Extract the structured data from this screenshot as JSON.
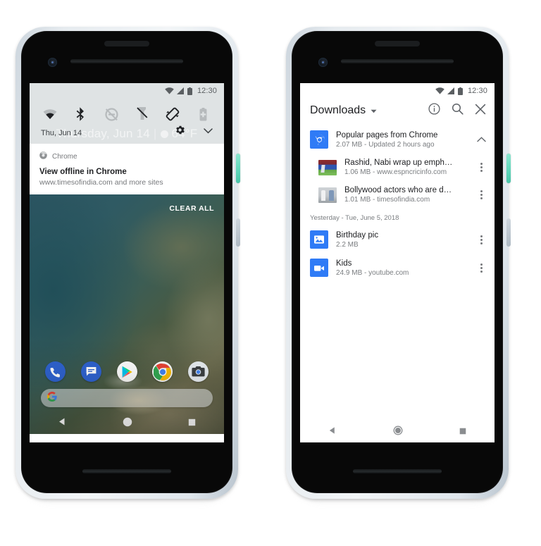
{
  "left_phone": {
    "name": "pixel-phone-quick-settings",
    "status_bar": {
      "time": "12:30",
      "icons": [
        "wifi-icon",
        "signal-icon",
        "battery-icon"
      ]
    },
    "quick_settings": {
      "tiles": [
        {
          "name": "wifi-tile",
          "label": "Wi-Fi"
        },
        {
          "name": "bluetooth-tile",
          "label": "Bluetooth"
        },
        {
          "name": "do-not-disturb-tile",
          "label": "Do Not Disturb"
        },
        {
          "name": "flashlight-tile",
          "label": "Flashlight"
        },
        {
          "name": "auto-rotate-tile",
          "label": "Auto-rotate"
        },
        {
          "name": "battery-saver-tile",
          "label": "Battery Saver"
        }
      ],
      "ghost_widget": "Thursday, Jun 14",
      "ghost_temp": "64°F",
      "date": "Thu, Jun 14",
      "settings_icon": "gear-icon",
      "expand_icon": "chevron-down-icon"
    },
    "notification": {
      "app_icon": "chrome-icon",
      "app_name": "Chrome",
      "title": "View offline in Chrome",
      "subtitle": "www.timesofindia.com and more sites"
    },
    "clear_all_label": "CLEAR ALL",
    "dock": [
      {
        "name": "phone-app-icon",
        "label": "Phone"
      },
      {
        "name": "messages-app-icon",
        "label": "Messages"
      },
      {
        "name": "play-store-app-icon",
        "label": "Play Store"
      },
      {
        "name": "chrome-app-icon",
        "label": "Chrome"
      },
      {
        "name": "camera-app-icon",
        "label": "Camera"
      }
    ],
    "search_bar": {
      "icon": "google-g-icon",
      "placeholder": ""
    },
    "nav_bar": [
      "back-nav-button",
      "home-nav-button",
      "recents-nav-button"
    ]
  },
  "right_phone": {
    "name": "pixel-phone-downloads",
    "status_bar": {
      "time": "12:30",
      "icons": [
        "wifi-icon",
        "signal-icon",
        "battery-icon"
      ]
    },
    "app_bar": {
      "title": "Downloads",
      "caret_icon": "caret-down-icon",
      "actions": [
        {
          "name": "info-button",
          "icon": "info-circle-icon"
        },
        {
          "name": "search-button",
          "icon": "search-icon"
        },
        {
          "name": "close-button",
          "icon": "close-x-icon"
        }
      ]
    },
    "groups": [
      {
        "name": "popular-pages-group",
        "icon": "chrome-icon",
        "title": "Popular pages from Chrome",
        "subtitle": "2.07 MB - Updated 2 hours ago",
        "collapse_icon": "chevron-up-icon",
        "children": [
          {
            "name": "download-item-cricket",
            "thumb": "cricket-thumbnail",
            "title": "Rashid, Nabi wrap up emph…",
            "subtitle": "1.06 MB - www.espncricinfo.com",
            "menu_icon": "kebab-menu-icon"
          },
          {
            "name": "download-item-bollywood",
            "thumb": "people-thumbnail",
            "title": "Bollywood actors who are d…",
            "subtitle": "1.01 MB - timesofindia.com",
            "menu_icon": "kebab-menu-icon"
          }
        ]
      }
    ],
    "section_date": "Yesterday - Tue, June 5, 2018",
    "items": [
      {
        "name": "download-item-birthday-pic",
        "icon": "image-icon",
        "title": "Birthday pic",
        "subtitle": "2.2 MB",
        "menu_icon": "kebab-menu-icon"
      },
      {
        "name": "download-item-kids",
        "icon": "video-icon",
        "title": "Kids",
        "subtitle": "24.9 MB - youtube.com",
        "menu_icon": "kebab-menu-icon"
      }
    ],
    "nav_bar": [
      "back-nav-button",
      "home-nav-button",
      "recents-nav-button"
    ]
  },
  "colors": {
    "accent_blue": "#2f7bf6",
    "quick_settings_bg": "#dfe3e4",
    "power_button": "#64d9bd",
    "text_primary": "#202124",
    "text_secondary": "#7a7d80"
  }
}
